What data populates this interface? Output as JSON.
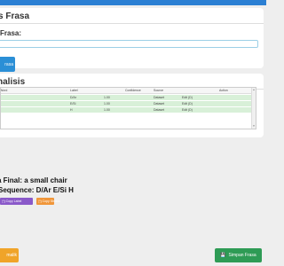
{
  "card1": {
    "title": "s Frasa",
    "field_label": "Frasa:",
    "input_value": "",
    "analyze_button": "rasa"
  },
  "card2": {
    "title": "nalisis",
    "columns": [
      "Word",
      "Label",
      "Confidence",
      "Source",
      "Action"
    ],
    "rows": [
      {
        "word": "",
        "label": "D/Ar",
        "confidence": "1.00",
        "source": "Dataset",
        "action": "Edit (D)"
      },
      {
        "word": "",
        "label": "E/Si",
        "confidence": "1.00",
        "source": "Dataset",
        "action": "Edit (D)"
      },
      {
        "word": "",
        "label": "H",
        "confidence": "1.00",
        "source": "Dataset",
        "action": "Edit (D)"
      }
    ]
  },
  "result": {
    "line1": "a Final: a small chair",
    "line2": "Sequence: D/Ar E/Si H"
  },
  "buttons": {
    "copy_label": "Copy Label",
    "copy_structure": "Copy Struktu",
    "bottom_left": "malik",
    "save": "Simpan Frasa"
  },
  "colors": {
    "accent_blue": "#2b8fd6",
    "row_green": "#d8f0d8",
    "purple": "#8a59c9",
    "orange": "#f0963a",
    "yellow_orange": "#f0a429",
    "save_green": "#2e9b55"
  }
}
